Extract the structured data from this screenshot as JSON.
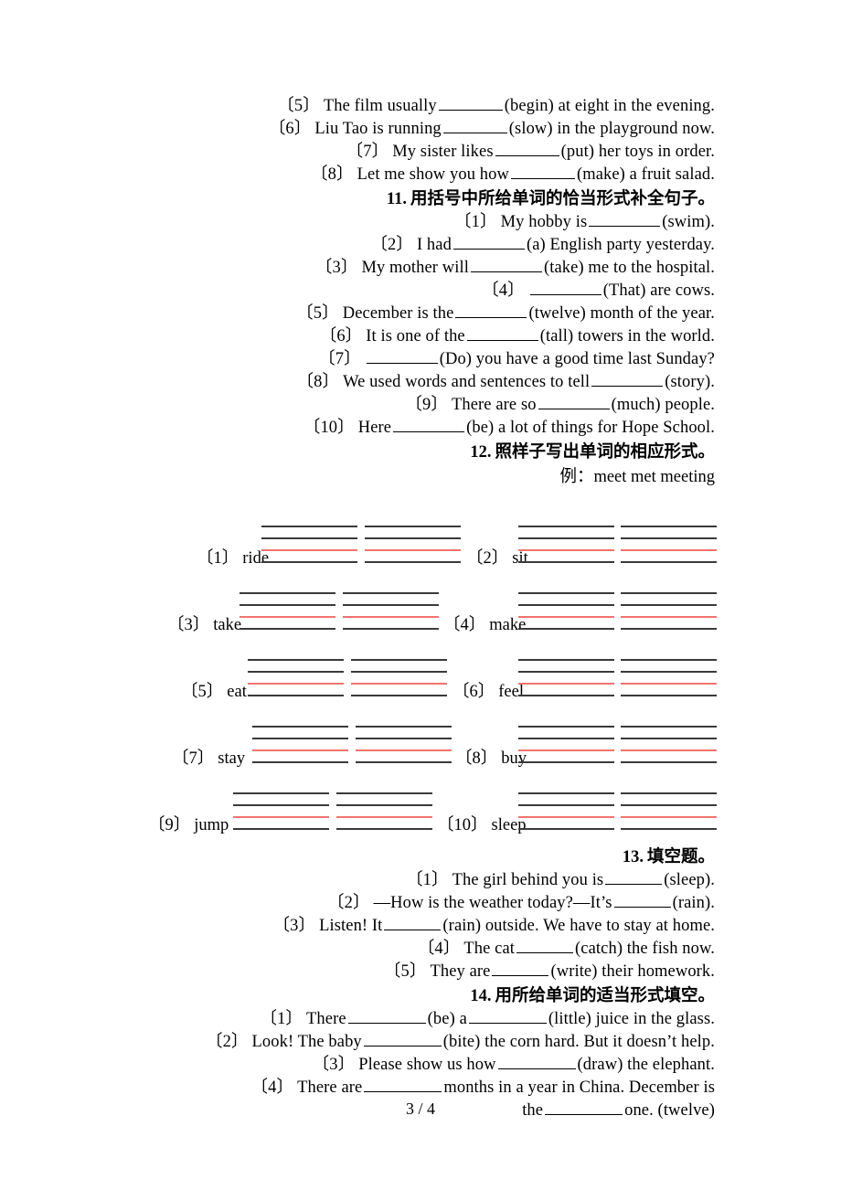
{
  "document": {
    "page_label": "3 / 4",
    "line_color_black": "#3a3a3a",
    "line_color_red": "#f2736d"
  },
  "section_10_tail": {
    "items": [
      "〔5〕The film usually ____ (begin) at eight in the evening.",
      "〔6〕Liu Tao is running ____ (slow) in the playground now.",
      "〔7〕My sister likes ____ (put) her toys in order.",
      "〔8〕Let me show you how ____ (make) a fruit salad."
    ],
    "parts": [
      {
        "num": "〔5〕",
        "before": "The film usually",
        "blank": "b70",
        "after": "(begin) at eight in the evening."
      },
      {
        "num": "〔6〕",
        "before": "Liu Tao is running",
        "blank": "b70",
        "after": "(slow) in the playground now."
      },
      {
        "num": "〔7〕",
        "before": "My sister likes",
        "blank": "b70",
        "after": "(put) her toys in order."
      },
      {
        "num": "〔8〕",
        "before": "Let me show you how",
        "blank": "b70",
        "after": "(make) a fruit salad."
      }
    ]
  },
  "section_11": {
    "number": "11.",
    "title": "用括号中所给单词的恰当形式补全句子。",
    "items": [
      {
        "num": "〔1〕",
        "before": "My hobby is",
        "blank": "b78",
        "after": "(swim)."
      },
      {
        "num": "〔2〕",
        "before": "I had",
        "blank": "b78",
        "after": "(a) English party yesterday."
      },
      {
        "num": "〔3〕",
        "before": "My mother will",
        "blank": "b78",
        "after": "(take) me to the hospital."
      },
      {
        "num": "〔4〕",
        "before": "",
        "blank": "b78",
        "after": "(That) are cows."
      },
      {
        "num": "〔5〕",
        "before": "December is the",
        "blank": "b78",
        "after": "(twelve) month of the year."
      },
      {
        "num": "〔6〕",
        "before": "It is one of the",
        "blank": "b78",
        "after": "(tall) towers in the world."
      },
      {
        "num": "〔7〕",
        "before": "",
        "blank": "b78",
        "after": "(Do) you have a good time last Sunday?"
      },
      {
        "num": "〔8〕",
        "before": "We used words and sentences to tell",
        "blank": "b78",
        "after": "(story)."
      },
      {
        "num": "〔9〕",
        "before": "There are so",
        "blank": "b78",
        "after": "(much) people."
      },
      {
        "num": "〔10〕",
        "before": "Here",
        "blank": "b78",
        "after": "(be) a lot of things for Hope School."
      }
    ]
  },
  "section_12": {
    "number": "12.",
    "title": "照样子写出单词的相应形式。",
    "example_label": "例：",
    "example_text": "meet met meeting",
    "rows": [
      {
        "left": {
          "num": "〔1〕",
          "word": "ride"
        },
        "right": {
          "num": "〔2〕",
          "word": "sit"
        }
      },
      {
        "left": {
          "num": "〔3〕",
          "word": "take"
        },
        "right": {
          "num": "〔4〕",
          "word": "make"
        }
      },
      {
        "left": {
          "num": "〔5〕",
          "word": "eat"
        },
        "right": {
          "num": "〔6〕",
          "word": "feel"
        }
      },
      {
        "left": {
          "num": "〔7〕",
          "word": "stay"
        },
        "right": {
          "num": "〔8〕",
          "word": "buy"
        }
      },
      {
        "left": {
          "num": "〔9〕",
          "word": "jump"
        },
        "right": {
          "num": "〔10〕",
          "word": "sleep"
        }
      }
    ]
  },
  "section_13": {
    "number": "13.",
    "title": "填空题。",
    "items": [
      {
        "num": "〔1〕",
        "before": "The girl behind you is",
        "blank": "b62",
        "after": "(sleep)."
      },
      {
        "num": "〔2〕",
        "before": "—How is the weather today?—It’s",
        "blank": "b62",
        "after": "(rain)."
      },
      {
        "num": "〔3〕",
        "before": "Listen! It",
        "blank": "b62",
        "after": "(rain) outside. We have to stay at home."
      },
      {
        "num": "〔4〕",
        "before": "The cat",
        "blank": "b62",
        "after": "(catch) the fish now."
      },
      {
        "num": "〔5〕",
        "before": "They are",
        "blank": "b62",
        "after": "(write) their homework."
      }
    ]
  },
  "section_14": {
    "number": "14.",
    "title": "用所给单词的适当形式填空。",
    "items": [
      {
        "num": "〔1〕",
        "before": "There",
        "blank": "b85",
        "mid": "(be) a",
        "blank2": "b85",
        "after": "(little) juice in the glass."
      },
      {
        "num": "〔2〕",
        "before": "Look! The baby",
        "blank": "b85",
        "after": "(bite) the corn hard. But it doesn’t help."
      },
      {
        "num": "〔3〕",
        "before": "Please show us how",
        "blank": "b85",
        "after": "(draw) the elephant."
      },
      {
        "num": "〔4〕",
        "before": "There are",
        "blank": "b85",
        "after": "months in a year in China. December is"
      },
      {
        "num": "",
        "before": "the",
        "blank": "b85",
        "after": "one. (twelve)"
      }
    ]
  }
}
